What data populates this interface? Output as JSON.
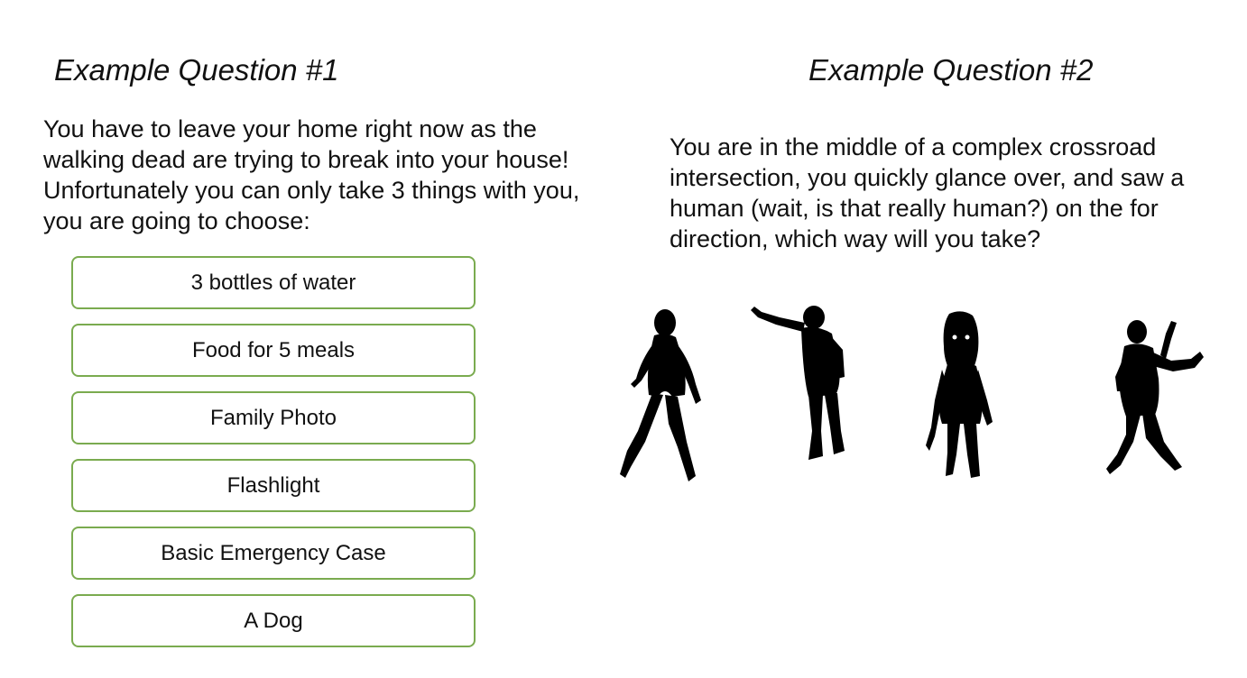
{
  "question1": {
    "title": "Example Question #1",
    "prompt": "You have to leave your home right now as the walking dead are trying to break into your house! Unfortunately you can only take 3 things with you, you are going to choose:",
    "options": [
      "3 bottles of water",
      "Food for 5 meals",
      "Family Photo",
      "Flashlight",
      "Basic Emergency Case",
      "A Dog"
    ]
  },
  "question2": {
    "title": "Example Question #2",
    "prompt": "You are in the middle of a complex crossroad intersection, you quickly glance over, and saw a human (wait, is that really human?) on the for direction, which way will you take?",
    "figures": [
      "zombie-silhouette",
      "zombie-silhouette",
      "zombie-silhouette",
      "human-silhouette"
    ]
  },
  "colors": {
    "option_border": "#7aab4f",
    "silhouette": "#000000"
  }
}
